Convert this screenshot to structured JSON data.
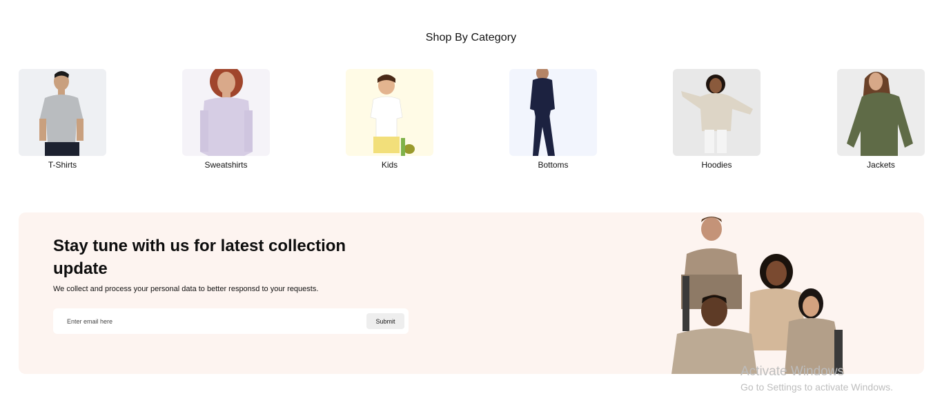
{
  "section": {
    "title": "Shop By Category"
  },
  "categories": [
    {
      "label": "T-Shirts",
      "icon": "tshirt-model-photo",
      "bg": "#eef0f3"
    },
    {
      "label": "Sweatshirts",
      "icon": "sweatshirt-model-photo",
      "bg": "#f5f3f8"
    },
    {
      "label": "Kids",
      "icon": "kids-model-photo",
      "bg": "#fffbe6"
    },
    {
      "label": "Bottoms",
      "icon": "bottoms-model-photo",
      "bg": "#f2f5fd"
    },
    {
      "label": "Hoodies",
      "icon": "hoodies-model-photo",
      "bg": "#e8e8e8"
    },
    {
      "label": "Jackets",
      "icon": "jackets-model-photo",
      "bg": "#ececec"
    }
  ],
  "newsletter": {
    "heading": "Stay tune with us for latest collection update",
    "description": "We collect and process your personal data to better responsd to your requests.",
    "email_placeholder": "Enter email here",
    "submit_label": "Submit",
    "bg": "#fdf4f0"
  },
  "watermark": {
    "line1": "Activate Windows",
    "line2": "Go to Settings to activate Windows."
  }
}
